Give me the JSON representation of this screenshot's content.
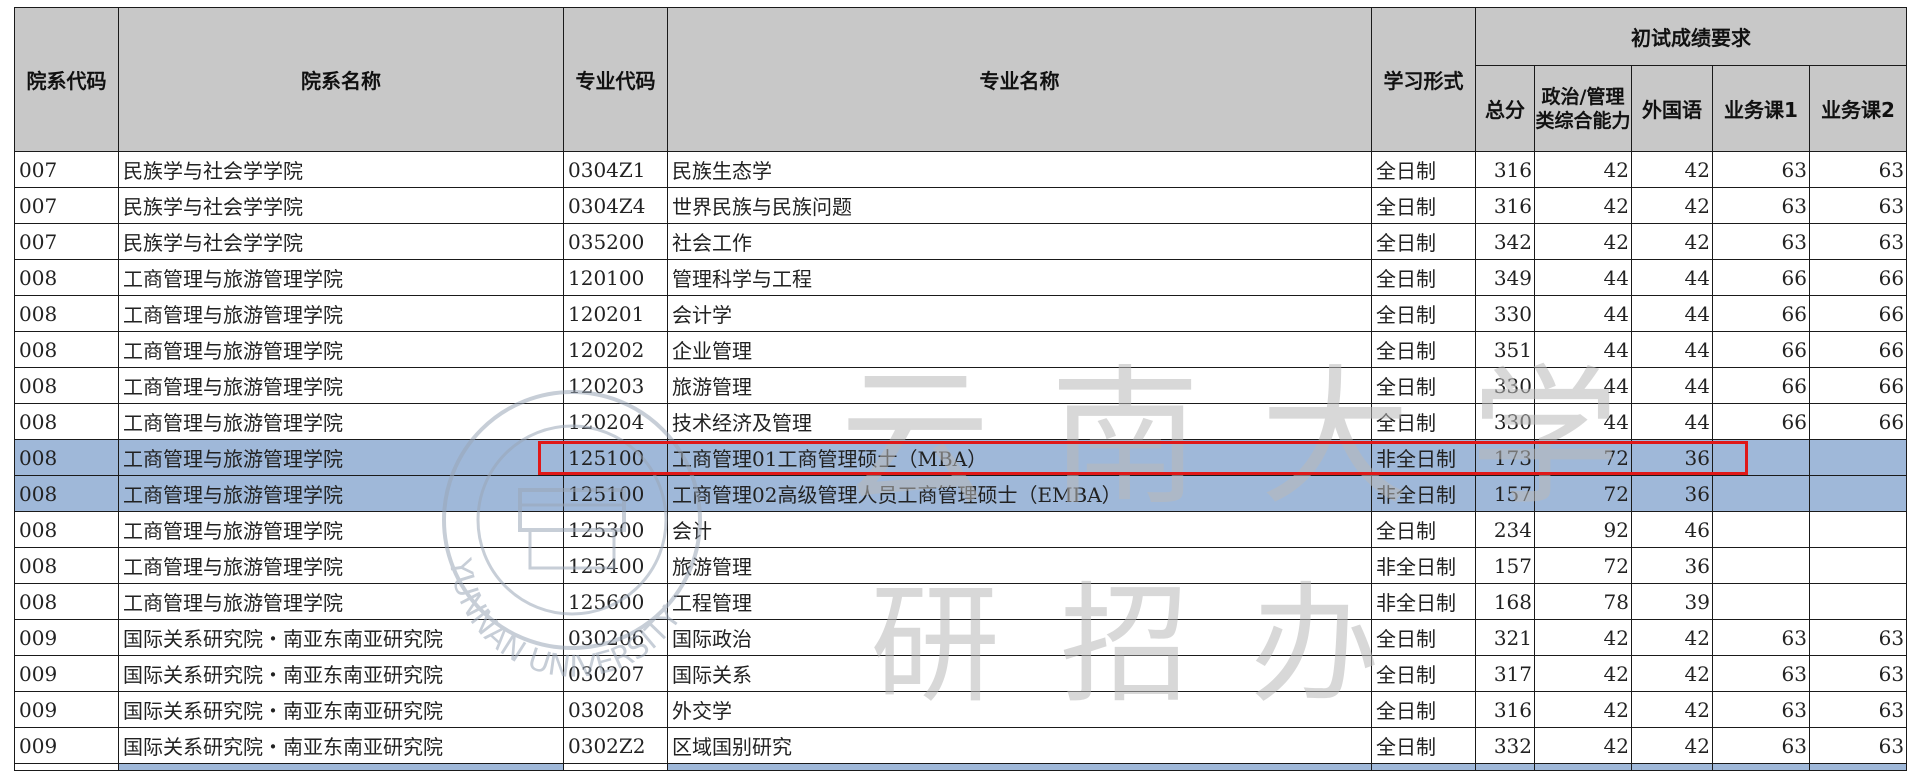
{
  "header": {
    "col_dept_code": "院系代码",
    "col_dept_name": "院系名称",
    "col_major_code": "专业代码",
    "col_major_name": "专业名称",
    "col_study_mode": "学习形式",
    "group_title": "初试成绩要求",
    "col_total": "总分",
    "col_politics": "政治/管理类综合能力",
    "col_foreign": "外国语",
    "col_course1": "业务课1",
    "col_course2": "业务课2"
  },
  "rows": [
    {
      "dept_code": "007",
      "dept_name": "民族学与社会学学院",
      "major_code": "0304Z1",
      "major_name": "民族生态学",
      "mode": "全日制",
      "total": "316",
      "politics": "42",
      "foreign": "42",
      "c1": "63",
      "c2": "63"
    },
    {
      "dept_code": "007",
      "dept_name": "民族学与社会学学院",
      "major_code": "0304Z4",
      "major_name": "世界民族与民族问题",
      "mode": "全日制",
      "total": "316",
      "politics": "42",
      "foreign": "42",
      "c1": "63",
      "c2": "63"
    },
    {
      "dept_code": "007",
      "dept_name": "民族学与社会学学院",
      "major_code": "035200",
      "major_name": "社会工作",
      "mode": "全日制",
      "total": "342",
      "politics": "42",
      "foreign": "42",
      "c1": "63",
      "c2": "63"
    },
    {
      "dept_code": "008",
      "dept_name": "工商管理与旅游管理学院",
      "major_code": "120100",
      "major_name": "管理科学与工程",
      "mode": "全日制",
      "total": "349",
      "politics": "44",
      "foreign": "44",
      "c1": "66",
      "c2": "66"
    },
    {
      "dept_code": "008",
      "dept_name": "工商管理与旅游管理学院",
      "major_code": "120201",
      "major_name": "会计学",
      "mode": "全日制",
      "total": "330",
      "politics": "44",
      "foreign": "44",
      "c1": "66",
      "c2": "66"
    },
    {
      "dept_code": "008",
      "dept_name": "工商管理与旅游管理学院",
      "major_code": "120202",
      "major_name": "企业管理",
      "mode": "全日制",
      "total": "351",
      "politics": "44",
      "foreign": "44",
      "c1": "66",
      "c2": "66"
    },
    {
      "dept_code": "008",
      "dept_name": "工商管理与旅游管理学院",
      "major_code": "120203",
      "major_name": "旅游管理",
      "mode": "全日制",
      "total": "330",
      "politics": "44",
      "foreign": "44",
      "c1": "66",
      "c2": "66"
    },
    {
      "dept_code": "008",
      "dept_name": "工商管理与旅游管理学院",
      "major_code": "120204",
      "major_name": "技术经济及管理",
      "mode": "全日制",
      "total": "330",
      "politics": "44",
      "foreign": "44",
      "c1": "66",
      "c2": "66"
    },
    {
      "dept_code": "008",
      "dept_name": "工商管理与旅游管理学院",
      "major_code": "125100",
      "major_name": "工商管理01工商管理硕士（MBA）",
      "mode": "非全日制",
      "total": "173",
      "politics": "72",
      "foreign": "36",
      "c1": "",
      "c2": "",
      "highlight": true
    },
    {
      "dept_code": "008",
      "dept_name": "工商管理与旅游管理学院",
      "major_code": "125100",
      "major_name": "工商管理02高级管理人员工商管理硕士（EMBA）",
      "mode": "非全日制",
      "total": "157",
      "politics": "72",
      "foreign": "36",
      "c1": "",
      "c2": "",
      "highlight": true
    },
    {
      "dept_code": "008",
      "dept_name": "工商管理与旅游管理学院",
      "major_code": "125300",
      "major_name": "会计",
      "mode": "全日制",
      "total": "234",
      "politics": "92",
      "foreign": "46",
      "c1": "",
      "c2": ""
    },
    {
      "dept_code": "008",
      "dept_name": "工商管理与旅游管理学院",
      "major_code": "125400",
      "major_name": "旅游管理",
      "mode": "非全日制",
      "total": "157",
      "politics": "72",
      "foreign": "36",
      "c1": "",
      "c2": ""
    },
    {
      "dept_code": "008",
      "dept_name": "工商管理与旅游管理学院",
      "major_code": "125600",
      "major_name": "工程管理",
      "mode": "非全日制",
      "total": "168",
      "politics": "78",
      "foreign": "39",
      "c1": "",
      "c2": ""
    },
    {
      "dept_code": "009",
      "dept_name": "国际关系研究院・南亚东南亚研究院",
      "major_code": "030206",
      "major_name": "国际政治",
      "mode": "全日制",
      "total": "321",
      "politics": "42",
      "foreign": "42",
      "c1": "63",
      "c2": "63"
    },
    {
      "dept_code": "009",
      "dept_name": "国际关系研究院・南亚东南亚研究院",
      "major_code": "030207",
      "major_name": "国际关系",
      "mode": "全日制",
      "total": "317",
      "politics": "42",
      "foreign": "42",
      "c1": "63",
      "c2": "63"
    },
    {
      "dept_code": "009",
      "dept_name": "国际关系研究院・南亚东南亚研究院",
      "major_code": "030208",
      "major_name": "外交学",
      "mode": "全日制",
      "total": "316",
      "politics": "42",
      "foreign": "42",
      "c1": "63",
      "c2": "63"
    },
    {
      "dept_code": "009",
      "dept_name": "国际关系研究院・南亚东南亚研究院",
      "major_code": "0302Z2",
      "major_name": "区域国别研究",
      "mode": "全日制",
      "total": "332",
      "politics": "42",
      "foreign": "42",
      "c1": "63",
      "c2": "63"
    }
  ],
  "watermark": {
    "main_text": "云南大学",
    "sub_text": "研招办",
    "seal_text": "YUNNAN UNIVERSITY",
    "seal_icon": "university-seal-icon",
    "color": "#b9b9b9"
  },
  "annotation": {
    "color": "#e01818"
  }
}
